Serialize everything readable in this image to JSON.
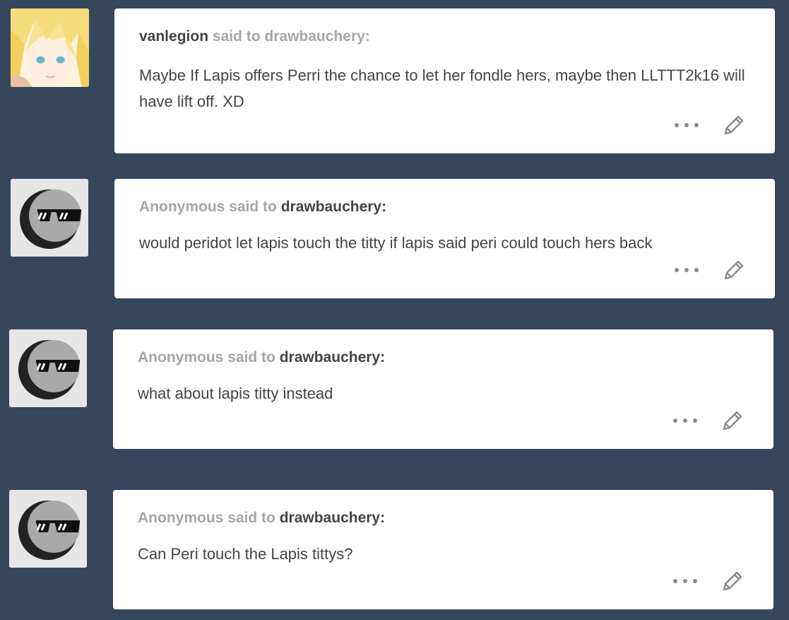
{
  "posts": [
    {
      "sender": "vanlegion",
      "said_to": "said to",
      "recipient": "drawbauchery",
      "sender_bold": true,
      "recipient_bold": false,
      "message": "Maybe If Lapis offers Perri the chance to let her fondle hers, maybe then LLTTT2k16 will have lift off. XD",
      "avatar": "anime-avatar-icon"
    },
    {
      "sender": "Anonymous",
      "said_to": "said to",
      "recipient": "drawbauchery",
      "sender_bold": false,
      "recipient_bold": true,
      "message": "would peridot let lapis touch the titty if lapis said peri could touch hers back",
      "avatar": "anonymous-sunglasses-icon"
    },
    {
      "sender": "Anonymous",
      "said_to": "said to",
      "recipient": "drawbauchery",
      "sender_bold": false,
      "recipient_bold": true,
      "message": "what about lapis titty instead",
      "avatar": "anonymous-sunglasses-icon"
    },
    {
      "sender": "Anonymous",
      "said_to": "said to",
      "recipient": "drawbauchery",
      "sender_bold": false,
      "recipient_bold": true,
      "message": "Can Peri touch the Lapis tittys?",
      "avatar": "anonymous-sunglasses-icon"
    }
  ],
  "colors": {
    "background": "#36465d",
    "card": "#ffffff",
    "text": "#444444",
    "muted": "#a6a6a6"
  }
}
